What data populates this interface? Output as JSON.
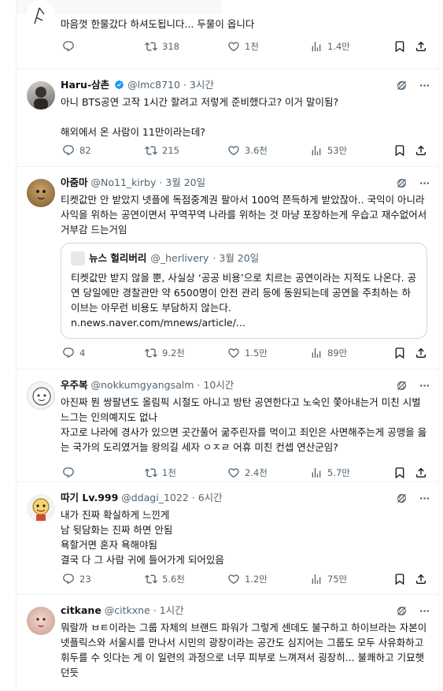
{
  "tweets": [
    {
      "id": "t0",
      "name": "",
      "handle": "",
      "time": "",
      "verified": false,
      "text": "마음껏 한물갔다 하셔도됩니다... 두물이 옵니다",
      "stats": {
        "replies": "",
        "retweets": "318",
        "likes": "1천",
        "views": "1.4만"
      }
    },
    {
      "id": "t1",
      "name": "Haru-삼촌",
      "handle": "@lmc8710",
      "time": "· 3시간",
      "verified": true,
      "text": "아니 BTS공연 고작 1시간 할려고 저렇게 준비했다고? 이거 말이됨?\n\n해외에서 온 사람이 11만이라는데?",
      "stats": {
        "replies": "82",
        "retweets": "215",
        "likes": "3.6천",
        "views": "53만"
      }
    },
    {
      "id": "t2",
      "name": "아줌마",
      "handle": "@No11_kirby",
      "time": "· 3월 20일",
      "verified": false,
      "text": "티켓값만 안 받았지 넷플에 독점중계권 팔아서 100억 쯘득하게 받았잖아.. 국익이 아니라 사익을 위하는 공연이면서 꾸역꾸역 나라를 위하는 것 마냥  포장하는게 우습고 재수없어서 거부감 드는거임",
      "quote": {
        "name": "뉴스 헐리버리",
        "handle": "@_herlivery",
        "time": "· 3월 20일",
        "text": "티켓값만 받지 않을 뿐, 사실상 ‘공공 비용’으로 치르는 공연이라는 지적도 나온다. 공연 당일에만 경찰관만 약 6500명이 안전 관리 등에 동원되는데 공연을 주최하는 하이브는 아무런 비용도 부담하지 않는다.",
        "link": "n.news.naver.com/mnews/article/..."
      },
      "stats": {
        "replies": "4",
        "retweets": "9.2천",
        "likes": "1.5만",
        "views": "89만"
      }
    },
    {
      "id": "t3",
      "name": "우주복",
      "handle": "@nokkumgyangsalm",
      "time": "· 10시간",
      "verified": false,
      "text": "아진짜 뭔 쌍팔년도 올림픽 시절도 아니고 방탄 공연한다고 노숙인 쫓아내는거 미친 시벌 느그는 인의예지도 없나\n자고로 나라에 경사가 있으면 곳간풀어 굶주린자를 먹이고 죄인은 사면해주는게 공맹을 읊는 국가의 도리였거늘 왕의길 세자 ㅇㅈㄹ 어휴 미친 컨셉 연산군임?",
      "stats": {
        "replies": "",
        "retweets": "1천",
        "likes": "2.4천",
        "views": "5.7만"
      }
    },
    {
      "id": "t4",
      "name": "따기 Lv.999",
      "handle": "@ddagi_1022",
      "time": "· 6시간",
      "verified": false,
      "text": "내가 진짜 확실하게 느낀게\n남 뒷담화는 진짜 하면 안됨\n욕할거면 혼자 욕해야됨\n결국 다 그 사람 귀에 들어가게 되어있음",
      "stats": {
        "replies": "23",
        "retweets": "5.6천",
        "likes": "1.2만",
        "views": "75만"
      }
    },
    {
      "id": "t5",
      "name": "citkane",
      "handle": "@citkxne",
      "time": "· 1시간",
      "verified": false,
      "text": "뭐랄까 ㅂㅌ이라는 그룹 자체의 브랜드 파워가 그렇게 센데도 불구하고 하이브라는 자본이 넷플릭스와 서울시를 만나서 시민의 광장이라는 공간도 심지어는 그룹도 모두 사유화하고 휘두를 수 잇다는 게 이 일련의 과정으로 너무 피부로 느껴져서 굉장히... 불쾌하고 기묘햇던듯",
      "stats": {
        "replies": "",
        "retweets": "",
        "likes": "",
        "views": ""
      }
    }
  ],
  "colors": {
    "secondary": "#536471",
    "verified": "#1d9bf0",
    "border": "#eff3f4",
    "text": "#0f1419"
  },
  "icons": [
    "reply-icon",
    "retweet-icon",
    "like-icon",
    "views-icon",
    "bookmark-icon",
    "share-icon",
    "grok-icon",
    "more-icon",
    "verified-icon"
  ]
}
